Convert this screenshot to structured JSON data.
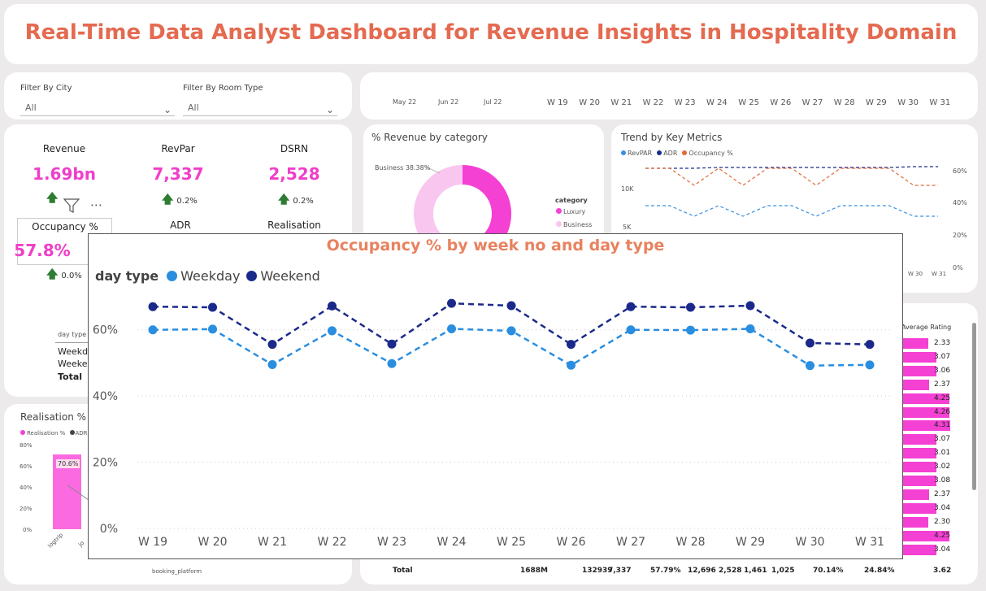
{
  "title": "Real-Time Data Analyst Dashboard for Revenue Insights in Hospitality Domain",
  "filters": [
    {
      "label": "Filter By City",
      "value": "All"
    },
    {
      "label": "Filter By Room Type",
      "value": "All"
    }
  ],
  "timeline": {
    "months": [
      "May 22",
      "Jun 22",
      "Jul 22"
    ],
    "weeks": [
      "W 19",
      "W 20",
      "W 21",
      "W 22",
      "W 23",
      "W 24",
      "W 25",
      "W 26",
      "W 27",
      "W 28",
      "W 29",
      "W 30",
      "W 31"
    ]
  },
  "kpis": [
    {
      "label": "Revenue",
      "value": "1.69bn",
      "delta": ""
    },
    {
      "label": "RevPar",
      "value": "7,337",
      "delta": "0.2%"
    },
    {
      "label": "DSRN",
      "value": "2,528",
      "delta": "0.2%"
    },
    {
      "label": "Occupancy %",
      "value": "57.8%",
      "delta": "0.0%"
    },
    {
      "label": "ADR",
      "value": "",
      "delta": ""
    },
    {
      "label": "Realisation",
      "value": "",
      "delta": ""
    }
  ],
  "daytype_table": {
    "header": "day type",
    "rows": [
      "Weekday",
      "Weekend",
      "Total"
    ]
  },
  "donut": {
    "title": "% Revenue by category",
    "slice_label": "Business 38.38%",
    "legend_title": "category",
    "legend": [
      {
        "name": "Luxury",
        "color": "#f540d4"
      },
      {
        "name": "Business",
        "color": "#f9c6ef"
      }
    ],
    "business_share": 38.38
  },
  "trend": {
    "title": "Trend by Key Metrics",
    "legend": [
      {
        "name": "RevPAR",
        "color": "#3a8fe0"
      },
      {
        "name": "ADR",
        "color": "#1b2a8a"
      },
      {
        "name": "Occupancy %",
        "color": "#e0693a"
      }
    ],
    "left_ticks": [
      "10K",
      "5K"
    ],
    "right_ticks": [
      "60%",
      "40%",
      "20%",
      "0%"
    ],
    "week_ticks": [
      "W 30",
      "W 31"
    ]
  },
  "realisation": {
    "title": "Realisation % a",
    "legend": [
      "Realisation %",
      "ADR"
    ],
    "yticks": [
      "80%",
      "60%",
      "40%",
      "20%",
      "0%"
    ],
    "bar_label": "70.6%",
    "bar_value": 70.6,
    "xlabels": [
      "logtrip",
      "jo"
    ],
    "xaxis_title": "booking_platform"
  },
  "property_table": {
    "header_rating": "Average Rating",
    "ratings": [
      "2.33",
      "3.07",
      "3.06",
      "2.37",
      "4.25",
      "4.26",
      "4.31",
      "3.07",
      "3.01",
      "3.02",
      "3.08",
      "2.37",
      "3.04",
      "2.30",
      "4.25",
      "3.04"
    ],
    "totals": [
      "Total",
      "1688M",
      "132939",
      "7,337",
      "57.79%",
      "12,696",
      "2,528",
      "1,461",
      "1,025",
      "70.14%",
      "24.84%",
      "3.62"
    ]
  },
  "chart_data": {
    "type": "line",
    "title": "Occupancy % by week no and day type",
    "legend_title": "day type",
    "legend_position": "top-left",
    "categories": [
      "W 19",
      "W 20",
      "W 21",
      "W 22",
      "W 23",
      "W 24",
      "W 25",
      "W 26",
      "W 27",
      "W 28",
      "W 29",
      "W 30",
      "W 31"
    ],
    "series": [
      {
        "name": "Weekday",
        "color": "#2a8ee0",
        "values": [
          60,
          60.2,
          49.5,
          59.7,
          49.8,
          60.3,
          59.7,
          49.3,
          60,
          59.9,
          60.3,
          49.2,
          49.4
        ]
      },
      {
        "name": "Weekend",
        "color": "#1b2a8a",
        "values": [
          67,
          66.8,
          55.6,
          67.2,
          55.7,
          68,
          67.3,
          55.6,
          67,
          66.8,
          67.3,
          56,
          55.6
        ]
      }
    ],
    "yticks": [
      "0%",
      "20%",
      "40%",
      "60%"
    ],
    "ylim": [
      0,
      70
    ],
    "grid": true
  }
}
